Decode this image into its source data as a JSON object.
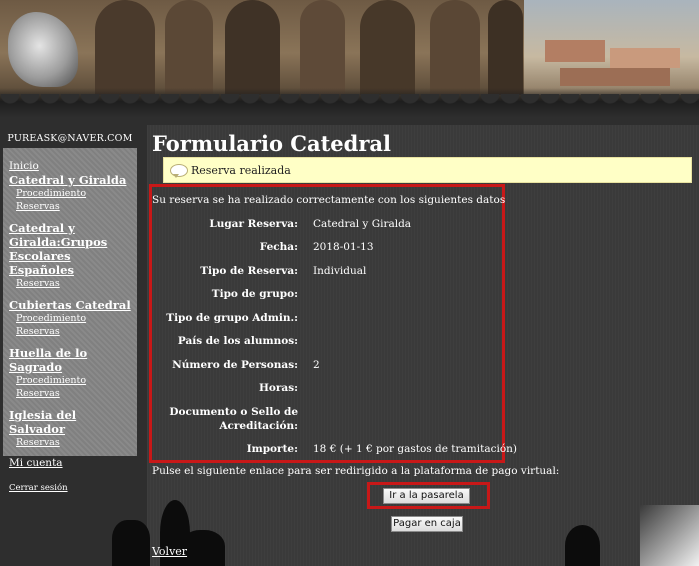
{
  "user": {
    "email": "PUREASK@NAVER.COM"
  },
  "sidebar": {
    "home": "Inicio",
    "sections": [
      {
        "title": "Catedral y Giralda",
        "links": [
          "Procedimiento",
          "Reservas"
        ]
      },
      {
        "title": "Catedral y Giralda:Grupos Escolares Españoles",
        "links": [
          "Reservas"
        ]
      },
      {
        "title": "Cubiertas Catedral",
        "links": [
          "Procedimiento",
          "Reservas"
        ]
      },
      {
        "title": "Huella de lo Sagrado",
        "links": [
          "Procedimiento",
          "Reservas"
        ]
      },
      {
        "title": "Iglesia del Salvador",
        "links": [
          "Reservas"
        ]
      }
    ],
    "account": "Mi cuenta",
    "logout": "Cerrar sesión"
  },
  "main": {
    "title": "Formulario Catedral",
    "notice": "Reserva realizada",
    "intro": "Su reserva se ha realizado correctamente con los siguientes datos",
    "fields": [
      {
        "label": "Lugar Reserva:",
        "value": "Catedral y Giralda"
      },
      {
        "label": "Fecha:",
        "value": "2018-01-13"
      },
      {
        "label": "Tipo de Reserva:",
        "value": "Individual"
      },
      {
        "label": "Tipo de grupo:",
        "value": ""
      },
      {
        "label": "Tipo de grupo Admin.:",
        "value": ""
      },
      {
        "label": "País de los alumnos:",
        "value": ""
      },
      {
        "label": "Número de Personas:",
        "value": "2"
      },
      {
        "label": "Horas:",
        "value": ""
      },
      {
        "label": "Documento o Sello de Acreditación:",
        "value": ""
      },
      {
        "label": "Importe:",
        "value": "18 € (+ 1 € por gastos de tramitación)"
      }
    ],
    "redirect_text": "Pulse el siguiente enlace para ser redirigido a la plataforma de pago virtual:",
    "pasarela_button": "Ir a la pasarela",
    "caja_button": "Pagar en caja",
    "back_link": "Volver"
  }
}
